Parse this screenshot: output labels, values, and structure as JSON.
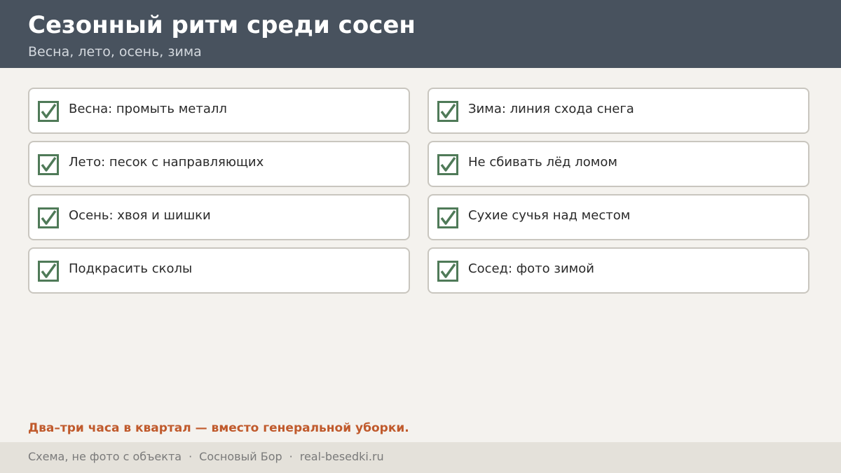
{
  "header": {
    "title": "Сезонный ритм среди сосен",
    "subtitle": "Весна, лето, осень, зима"
  },
  "checklist": {
    "left": [
      {
        "label": "Весна: промыть металл",
        "checked": true
      },
      {
        "label": "Лето: песок с направляющих",
        "checked": true
      },
      {
        "label": "Осень: хвоя и шишки",
        "checked": true
      },
      {
        "label": "Подкрасить сколы",
        "checked": true
      }
    ],
    "right": [
      {
        "label": "Зима: линия схода снега",
        "checked": true
      },
      {
        "label": "Не сбивать лёд ломом",
        "checked": true
      },
      {
        "label": "Сухие сучья над местом",
        "checked": true
      },
      {
        "label": "Сосед: фото зимой",
        "checked": true
      }
    ],
    "check_icon": "checkbox-checked-icon",
    "check_color": "#4f7a58"
  },
  "note": "Два–три часа в квартал — вместо генеральной уборки.",
  "footer": {
    "part1": "Схема, не фото с объекта",
    "separator": "·",
    "part2": "Сосновый Бор",
    "part3": "real-besedki.ru"
  },
  "colors": {
    "header_bg": "#48525e",
    "accent": "#c05a2c",
    "page_bg": "#f4f2ee"
  }
}
